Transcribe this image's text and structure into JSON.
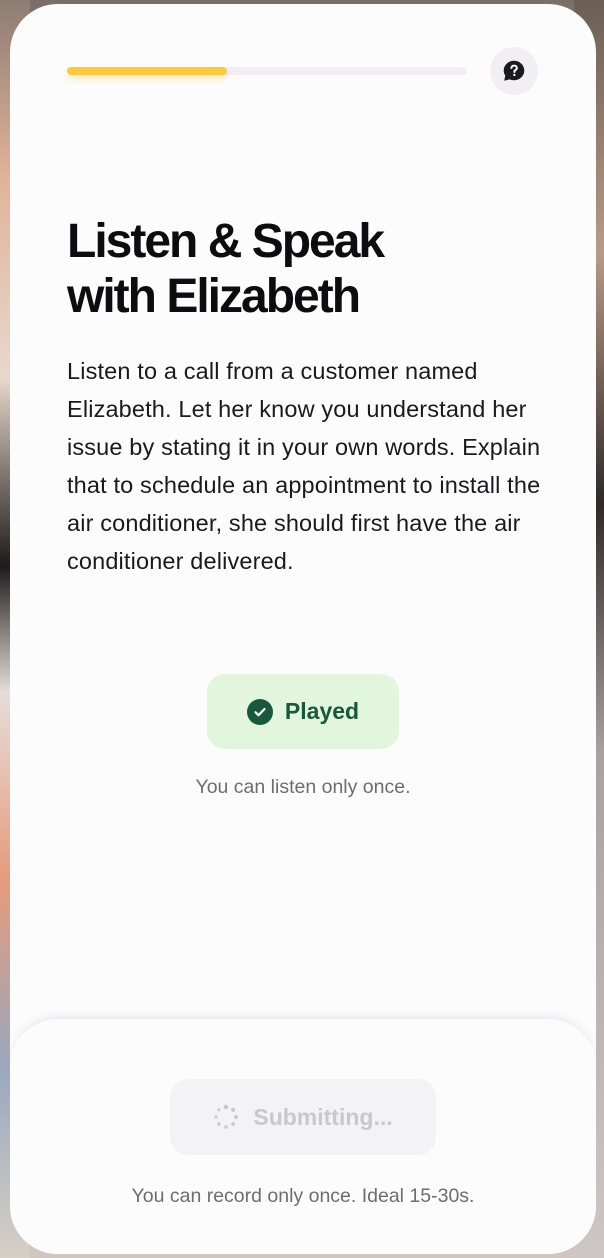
{
  "progress": {
    "value": 0.4,
    "color": "#ffc93c"
  },
  "header": {
    "help_icon": "question-bubble-icon"
  },
  "main": {
    "title_line1": "Listen & Speak",
    "title_line2": "with Elizabeth",
    "description": "Listen to a call from a customer named Elizabeth. Let her know you understand her issue by stating it in your own words. Explain that to schedule an appointment to install the air conditioner, she should first have the air conditioner delivered.",
    "played_button": {
      "label": "Played",
      "icon": "check-circle-icon",
      "color": "#18583f",
      "background": "#e2f5dd"
    },
    "listen_note": "You can listen only once."
  },
  "footer": {
    "submit_button": {
      "label": "Submitting...",
      "icon": "spinner-icon",
      "disabled": true
    },
    "record_note": "You can record only once. Ideal 15-30s."
  }
}
